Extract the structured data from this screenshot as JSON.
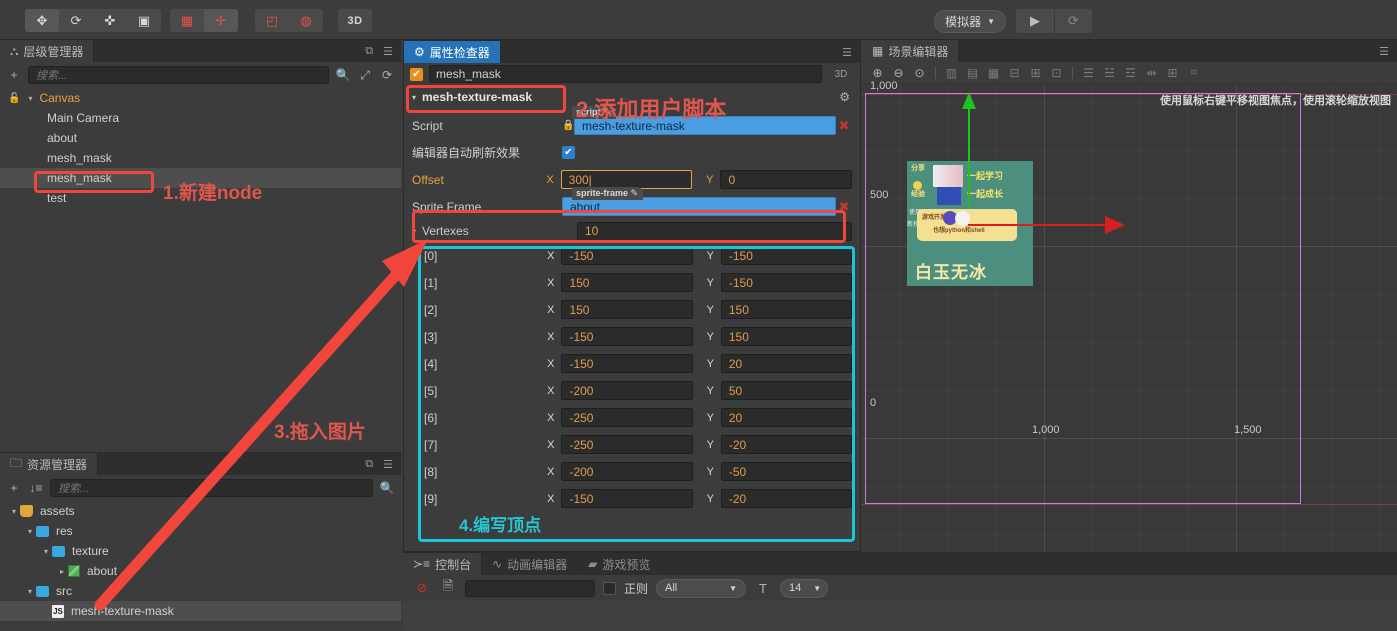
{
  "toolbar": {
    "tools": [
      {
        "name": "move-tool",
        "glyph": "✥"
      },
      {
        "name": "rotate-tool",
        "glyph": "⟳"
      },
      {
        "name": "scale-tool",
        "glyph": "✜"
      },
      {
        "name": "rect-tool",
        "glyph": "▣"
      }
    ],
    "group2": [
      {
        "name": "position-gizmo-toggle",
        "glyph": "▦"
      },
      {
        "name": "anchor-gizmo-toggle",
        "glyph": "✛"
      }
    ],
    "group3": [
      {
        "name": "local-coord-toggle",
        "glyph": "◰"
      },
      {
        "name": "pivot-toggle",
        "glyph": "◍"
      }
    ],
    "mode_3d_label": "3D",
    "simulator_label": "模拟器",
    "play_label": "▶",
    "refresh_label": "⟳"
  },
  "hierarchy": {
    "tab_label": "层级管理器",
    "search_placeholder": "搜索...",
    "add_label": "+",
    "items": [
      {
        "label": "Canvas",
        "depth": 0,
        "arrow": "▾",
        "selected": false,
        "orange": true
      },
      {
        "label": "Main Camera",
        "depth": 1,
        "arrow": "",
        "selected": false,
        "orange": false
      },
      {
        "label": "about",
        "depth": 1,
        "arrow": "",
        "selected": false,
        "orange": false
      },
      {
        "label": "mesh_mask",
        "depth": 1,
        "arrow": "",
        "selected": false,
        "orange": false
      },
      {
        "label": "mesh_mask",
        "depth": 1,
        "arrow": "",
        "selected": true,
        "orange": false
      },
      {
        "label": "test",
        "depth": 1,
        "arrow": "",
        "selected": false,
        "orange": false
      }
    ]
  },
  "assets": {
    "tab_label": "资源管理器",
    "search_placeholder": "搜索...",
    "add_label": "+",
    "sort_label": "↓≡",
    "items": [
      {
        "label": "assets",
        "depth": 0,
        "arrow": "▾",
        "icon": "assets",
        "selected": false
      },
      {
        "label": "res",
        "depth": 1,
        "arrow": "▾",
        "icon": "folder",
        "selected": false
      },
      {
        "label": "texture",
        "depth": 2,
        "arrow": "▾",
        "icon": "folder",
        "selected": false
      },
      {
        "label": "about",
        "depth": 3,
        "arrow": "▸",
        "icon": "image",
        "selected": false
      },
      {
        "label": "src",
        "depth": 1,
        "arrow": "▾",
        "icon": "folder",
        "selected": false
      },
      {
        "label": "mesh-texture-mask",
        "depth": 2,
        "arrow": "",
        "icon": "js",
        "selected": true
      }
    ]
  },
  "inspector": {
    "tab_label": "属性检查器",
    "node_enabled": true,
    "node_name": "mesh_mask",
    "mode_3d_label": "3D",
    "component_title": "mesh-texture-mask",
    "component_arrow": "▾",
    "rows": {
      "script_label": "Script",
      "script_tag": "script",
      "script_value": "mesh-texture-mask",
      "auto_refresh_label": "编辑器自动刷新效果",
      "auto_refresh_checked": true,
      "offset_label": "Offset",
      "offset_x_axis": "X",
      "offset_x": "300",
      "offset_y_axis": "Y",
      "offset_y": "0",
      "sprite_frame_label": "Sprite Frame",
      "sprite_frame_tag": "sprite-frame",
      "sprite_frame_value": "about",
      "vertexes_label": "Vertexes",
      "vertexes_arrow": "▾",
      "vertexes_count": "10",
      "axis_x": "X",
      "axis_y": "Y"
    },
    "vertexes": [
      {
        "index": "[0]",
        "x": "-150",
        "y": "-150"
      },
      {
        "index": "[1]",
        "x": "150",
        "y": "-150"
      },
      {
        "index": "[2]",
        "x": "150",
        "y": "150"
      },
      {
        "index": "[3]",
        "x": "-150",
        "y": "150"
      },
      {
        "index": "[4]",
        "x": "-150",
        "y": "20"
      },
      {
        "index": "[5]",
        "x": "-200",
        "y": "50"
      },
      {
        "index": "[6]",
        "x": "-250",
        "y": "20"
      },
      {
        "index": "[7]",
        "x": "-250",
        "y": "-20"
      },
      {
        "index": "[8]",
        "x": "-200",
        "y": "-50"
      },
      {
        "index": "[9]",
        "x": "-150",
        "y": "-20"
      }
    ]
  },
  "scene": {
    "tab_label": "场景编辑器",
    "hint": "使用鼠标右键平移视图焦点，使用滚轮缩放视图",
    "tools": [
      {
        "name": "zoom-in-icon",
        "glyph": "⊕"
      },
      {
        "name": "zoom-out-icon",
        "glyph": "⊖"
      },
      {
        "name": "zoom-fit-icon",
        "glyph": "⊙"
      },
      {
        "name": "align-left-icon",
        "glyph": "▥"
      },
      {
        "name": "align-center-h-icon",
        "glyph": "▤"
      },
      {
        "name": "align-right-icon",
        "glyph": "▦"
      },
      {
        "name": "align-top-icon",
        "glyph": "⊟"
      },
      {
        "name": "align-middle-v-icon",
        "glyph": "⊞"
      },
      {
        "name": "align-bottom-icon",
        "glyph": "⊡"
      },
      {
        "name": "distribute-h-icon",
        "glyph": "☰"
      },
      {
        "name": "distribute-v-icon",
        "glyph": "☱"
      },
      {
        "name": "distribute-even-icon",
        "glyph": "☲"
      },
      {
        "name": "snap-icon",
        "glyph": "⇹"
      },
      {
        "name": "grid-icon",
        "glyph": "⊞"
      },
      {
        "name": "gizmo-icon",
        "glyph": "⌗"
      }
    ],
    "ruler_y": [
      "1,000",
      "500",
      "0"
    ],
    "ruler_x": [
      "1,000",
      "1,500"
    ],
    "sprite_texts": {
      "title": "白玉无冰",
      "line1": "一起学习",
      "line2": "一起成长",
      "bubble1": "游戏开发小萌新",
      "bubble2": "也想python和shell",
      "left1": "分享",
      "left2": "经验",
      "left3": "使用",
      "left4": "新技术"
    }
  },
  "console": {
    "tabs": [
      {
        "label": "控制台",
        "active": true,
        "icon": "≻≡"
      },
      {
        "label": "动画编辑器",
        "active": false,
        "icon": "∿"
      },
      {
        "label": "游戏预览",
        "active": false,
        "icon": "▰"
      }
    ],
    "clear_icon": "⊘",
    "file_icon": "🗎",
    "search_value": "",
    "regex_label": "正则",
    "regex_checked": false,
    "filter_label": "All",
    "filter_caret": "▼",
    "font_icon": "T",
    "font_size_label": "14",
    "font_caret": "▼"
  },
  "annotations": [
    {
      "text": "1.新建node",
      "color": "red"
    },
    {
      "text": "2.添加用户脚本",
      "color": "red"
    },
    {
      "text": "3.拖入图片",
      "color": "red"
    },
    {
      "text": "4.编写顶点",
      "color": "cyan"
    }
  ]
}
